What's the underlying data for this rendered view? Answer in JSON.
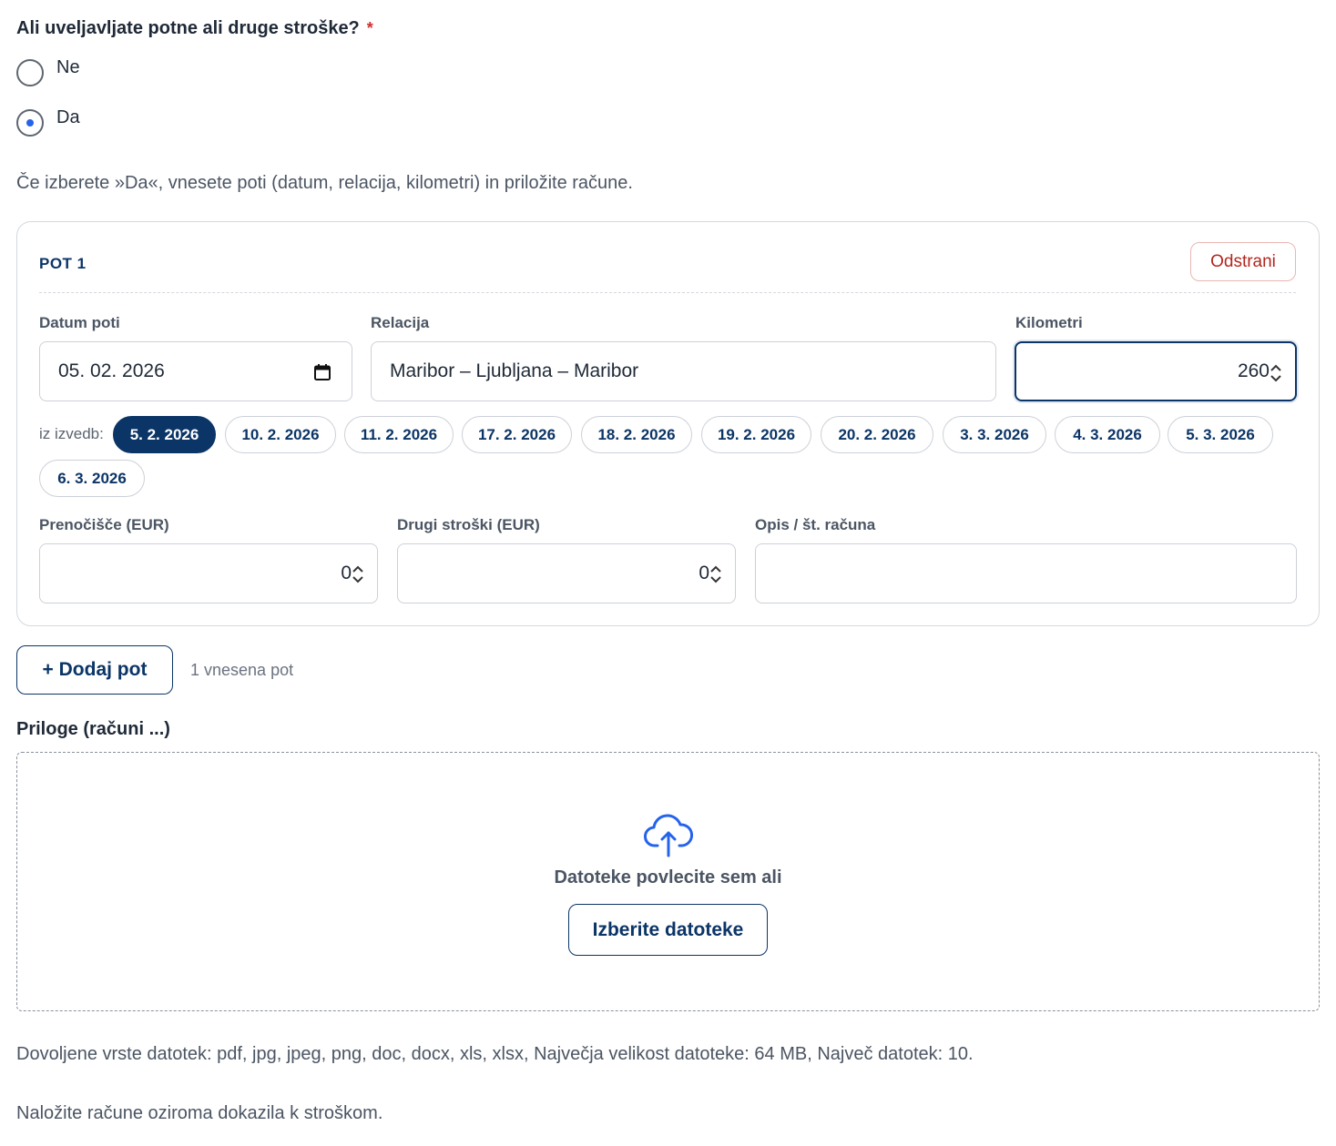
{
  "question": {
    "text": "Ali uveljavljate potne ali druge stroške?",
    "required_mark": "*"
  },
  "options": [
    {
      "label": "Ne",
      "checked": false
    },
    {
      "label": "Da",
      "checked": true
    }
  ],
  "hint": "Če izberete »Da«, vnesete poti (datum, relacija, kilometri) in priložite račune.",
  "trip": {
    "title": "POT 1",
    "remove_label": "Odstrani",
    "date": {
      "label": "Datum poti",
      "value": "05. 02. 2026"
    },
    "route": {
      "label": "Relacija",
      "value": "Maribor – Ljubljana – Maribor"
    },
    "km": {
      "label": "Kilometri",
      "value": "260"
    },
    "dates_label": "iz izvedb:",
    "dates": [
      "5. 2. 2026",
      "10. 2. 2026",
      "11. 2. 2026",
      "17. 2. 2026",
      "18. 2. 2026",
      "19. 2. 2026",
      "20. 2. 2026",
      "3. 3. 2026",
      "4. 3. 2026",
      "5. 3. 2026",
      "6. 3. 2026"
    ],
    "active_date": "5. 2. 2026",
    "lodging": {
      "label": "Prenočišče (EUR)",
      "value": "0"
    },
    "other": {
      "label": "Drugi stroški (EUR)",
      "value": "0"
    },
    "desc": {
      "label": "Opis / št. računa",
      "value": ""
    }
  },
  "add_trip_label": "+ Dodaj pot",
  "trip_count": "1 vnesena pot",
  "attachments": {
    "label": "Priloge (računi ...)",
    "drop_text": "Datoteke povlecite sem ali",
    "choose_label": "Izberite datoteke",
    "icon": "cloud-upload-icon"
  },
  "allowed_text": "Dovoljene vrste datotek: pdf, jpg, jpeg, png, doc, docx, xls, xlsx, Največja velikost datoteke: 64 MB, Največ datotek: 10.",
  "footer_hint": "Naložite račune oziroma dokazila k stroškom.",
  "colors": {
    "primary": "#0b3566",
    "radio_accent": "#2563eb",
    "danger": "#b3261e",
    "required": "#d32f2f"
  }
}
